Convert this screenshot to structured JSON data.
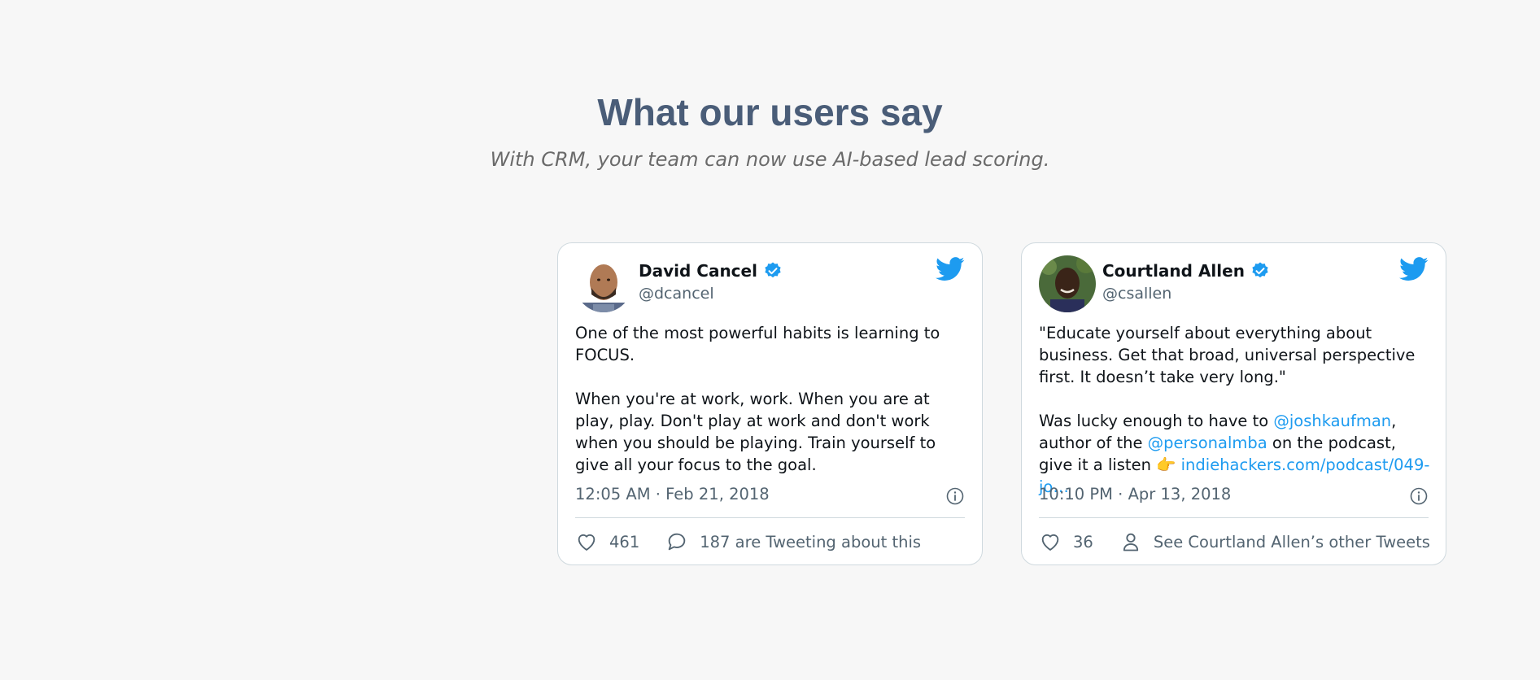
{
  "section": {
    "title": "What our users say",
    "subtitle": "With CRM, your team can now use AI-based lead scoring."
  },
  "tweets": [
    {
      "author_name": "David Cancel",
      "author_handle": "@dcancel",
      "verified": true,
      "paragraph_1": "One of the most powerful habits is learning to FOCUS.",
      "paragraph_2": "When you're at work, work. When you are at play, play. Don't play at work and don't work when you should be playing. Train yourself to give all your focus to the goal.",
      "timestamp": "12:05 AM · Feb 21, 2018",
      "likes": "461",
      "secondary_action": "187 are Tweeting about this",
      "secondary_icon": "reply-bubble-icon"
    },
    {
      "author_name": "Courtland Allen",
      "author_handle": "@csallen",
      "verified": true,
      "paragraph_1": "\"Educate yourself about everything about business. Get that broad, universal perspective first. It doesn’t take very long.\"",
      "p2_text_1": "Was lucky enough to have to ",
      "p2_link_1": "@joshkaufman",
      "p2_text_2": ", author of the ",
      "p2_link_2": "@personalmba",
      "p2_text_3": " on the podcast, give it a listen ",
      "p2_emoji": "👉",
      "p2_link_3": "indiehackers.com/podcast/049-jo…",
      "timestamp": "10:10 PM · Apr 13, 2018",
      "likes": "36",
      "secondary_action": "See Courtland Allen’s other Tweets",
      "secondary_icon": "person-icon"
    }
  ],
  "colors": {
    "title": "#4a5d78",
    "twitter_blue": "#1d9bf0",
    "muted": "#536471",
    "background": "#f7f7f7"
  }
}
